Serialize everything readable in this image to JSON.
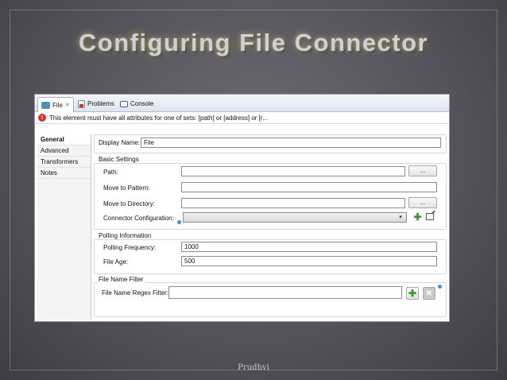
{
  "slide": {
    "title": "Configuring File Connector",
    "footer": "Prudhvi"
  },
  "editor": {
    "tabs": [
      {
        "label": "File",
        "icon": "file-icon",
        "active": true
      },
      {
        "label": "Problems",
        "icon": "problems-icon",
        "active": false
      },
      {
        "label": "Console",
        "icon": "console-icon",
        "active": false
      }
    ],
    "error_message": "This element must have all attributes for one of sets: [path] or [address] or [r...",
    "sidebar": [
      "General",
      "Advanced",
      "Transformers",
      "Notes"
    ],
    "display_name": {
      "label": "Display Name:",
      "value": "File"
    },
    "basic_settings": {
      "title": "Basic Settings",
      "path": {
        "label": "Path:",
        "value": "",
        "button": "..."
      },
      "move_to_pattern": {
        "label": "Move to Pattern:",
        "value": ""
      },
      "move_to_directory": {
        "label": "Move to Directory:",
        "value": "",
        "button": "..."
      },
      "connector_configuration": {
        "label": "Connector Configuration:",
        "value": ""
      }
    },
    "polling": {
      "title": "Polling Information",
      "frequency": {
        "label": "Polling Frequency:",
        "value": "1000"
      },
      "file_age": {
        "label": "File Age:",
        "value": "500"
      }
    },
    "filter": {
      "title": "File Name Filter",
      "regex": {
        "label": "File Name Regex Filter:",
        "value": ""
      }
    },
    "colors": {
      "error": "#d9332a",
      "add": "#3a9a2b",
      "info": "#3e8fd3"
    }
  }
}
